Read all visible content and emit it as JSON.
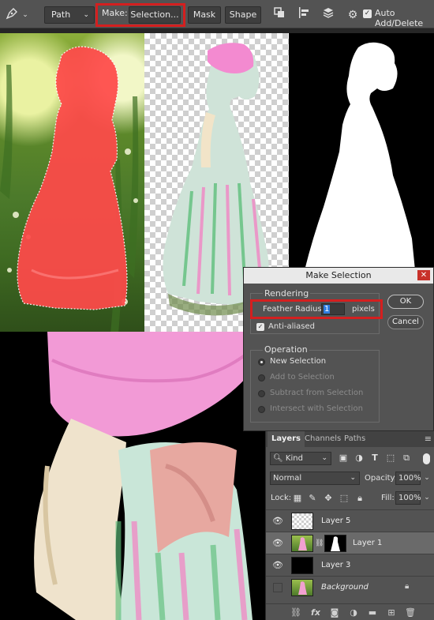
{
  "toolbar": {
    "mode_value": "Path",
    "make_label": "Make:",
    "selection_button": "Selection...",
    "mask_button": "Mask",
    "shape_button": "Shape",
    "auto_add_delete_label": "Auto Add/Delete",
    "auto_add_delete_checked": true,
    "icons": [
      "pen-tool-icon",
      "chevron-down-icon",
      "path-operations-icon",
      "path-alignment-icon",
      "path-arrangement-icon",
      "gear-icon"
    ]
  },
  "dialog": {
    "title": "Make Selection",
    "close_label": "✕",
    "rendering_label": "Rendering",
    "feather_label": "Feather Radius:",
    "feather_value": "1",
    "feather_unit": "pixels",
    "anti_aliased_label": "Anti-aliased",
    "anti_aliased_checked": true,
    "ok_button": "OK",
    "cancel_button": "Cancel",
    "operation_label": "Operation",
    "operations": [
      {
        "label": "New Selection",
        "selected": true,
        "enabled": true
      },
      {
        "label": "Add to Selection",
        "selected": false,
        "enabled": false
      },
      {
        "label": "Subtract from Selection",
        "selected": false,
        "enabled": false
      },
      {
        "label": "Intersect with Selection",
        "selected": false,
        "enabled": false
      }
    ]
  },
  "layers_panel": {
    "tabs": [
      "Layers",
      "Channels",
      "Paths"
    ],
    "active_tab": "Layers",
    "kind_filter": "Kind",
    "blend_mode": "Normal",
    "opacity_label": "Opacity:",
    "opacity_value": "100%",
    "lock_label": "Lock:",
    "fill_label": "Fill:",
    "fill_value": "100%",
    "layers": [
      {
        "name": "Layer 5",
        "visible": true,
        "selected": false
      },
      {
        "name": "Layer 1",
        "visible": true,
        "selected": true
      },
      {
        "name": "Layer 3",
        "visible": true,
        "selected": false
      },
      {
        "name": "Background",
        "visible": false,
        "selected": false,
        "locked": true
      }
    ]
  },
  "colors": {
    "highlight_red": "#d41f1f",
    "panel_gray": "#535353",
    "selection_overlay": "#ff4a4a",
    "dress_pink": "#f07fc0"
  }
}
